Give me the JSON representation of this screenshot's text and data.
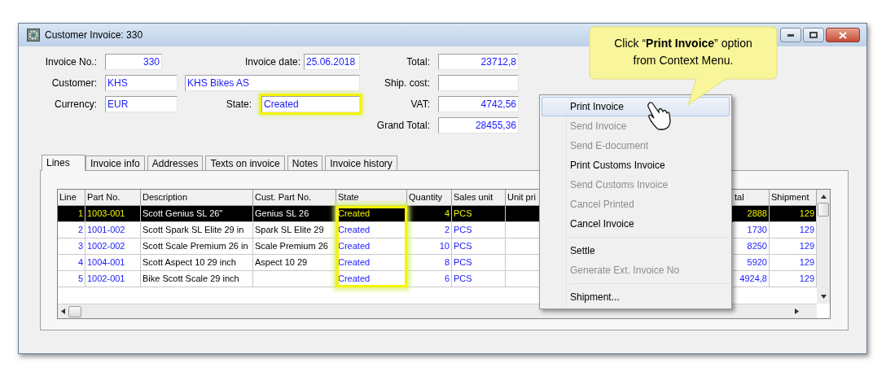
{
  "window": {
    "title": "Customer Invoice: 330"
  },
  "callout": {
    "text": "Click “**Print Invoice**” option from Context Menu."
  },
  "form": {
    "invoice_no": {
      "label": "Invoice No.:",
      "value": "330"
    },
    "invoice_date": {
      "label": "Invoice date:",
      "value": "25.06.2018"
    },
    "customer": {
      "label": "Customer:",
      "code": "KHS",
      "name": "KHS Bikes AS"
    },
    "currency": {
      "label": "Currency:",
      "value": "EUR"
    },
    "state": {
      "label": "State:",
      "value": "Created",
      "highlighted": true
    },
    "totals": [
      {
        "label": "Total:",
        "value": "23712,8"
      },
      {
        "label": "Ship. cost:"
      },
      {
        "label": "VAT:",
        "value": "4742,56"
      },
      {
        "label": "Grand Total:",
        "value": "28455,36"
      }
    ]
  },
  "tabs": [
    {
      "label": "Lines",
      "selected": true
    },
    {
      "label": "Invoice info",
      "selected": false
    },
    {
      "label": "Addresses",
      "selected": false
    },
    {
      "label": "Texts on invoice",
      "selected": false
    },
    {
      "label": "Notes",
      "selected": false
    },
    {
      "label": "Invoice history",
      "selected": false
    }
  ],
  "table": {
    "columns": [
      "Line",
      "Part No.",
      "Description",
      "Cust. Part No.",
      "State",
      "Quantity",
      "Sales unit",
      "Unit pri",
      "tal",
      "Shipment"
    ],
    "state_column_highlighted": true,
    "rows": [
      {
        "line": "1",
        "part_no": "1003-001",
        "description": "Scott Genius SL 26\"",
        "cust_part_no": "Genius SL 26",
        "state": "Created",
        "quantity": "4",
        "sales_unit": "PCS",
        "total": "2888",
        "shipment": "129",
        "selected": true
      },
      {
        "line": "2",
        "part_no": "1001-002",
        "description": "Scott Spark SL Elite 29 in",
        "cust_part_no": "Spark SL Elite 29",
        "state": "Created",
        "quantity": "2",
        "sales_unit": "PCS",
        "total": "1730",
        "shipment": "129",
        "selected": false
      },
      {
        "line": "3",
        "part_no": "1002-002",
        "description": "Scott Scale Premium 26 in",
        "cust_part_no": "Scale Premium 26",
        "state": "Created",
        "quantity": "10",
        "sales_unit": "PCS",
        "total": "8250",
        "shipment": "129",
        "selected": false
      },
      {
        "line": "4",
        "part_no": "1004-001",
        "description": "Scott Aspect 10 29 inch",
        "cust_part_no": "Aspect 10 29",
        "state": "Created",
        "quantity": "8",
        "sales_unit": "PCS",
        "total": "5920",
        "shipment": "129",
        "selected": false
      },
      {
        "line": "5",
        "part_no": "1002-001",
        "description": "Bike Scott Scale 29 inch",
        "state": "Created",
        "quantity": "6",
        "sales_unit": "PCS",
        "total": "4924,8",
        "shipment": "129",
        "selected": false
      }
    ]
  },
  "context_menu": {
    "items": [
      {
        "kind": "item",
        "label": "Print Invoice",
        "disabled": false,
        "selected": true
      },
      {
        "kind": "item",
        "label": "Send Invoice",
        "disabled": true,
        "selected": false
      },
      {
        "kind": "item",
        "label": "Send E-document",
        "disabled": true,
        "selected": false
      },
      {
        "kind": "item",
        "label": "Print Customs Invoice",
        "disabled": false,
        "selected": false
      },
      {
        "kind": "item",
        "label": "Send Customs Invoice",
        "disabled": true,
        "selected": false
      },
      {
        "kind": "item",
        "label": "Cancel Printed",
        "disabled": true,
        "selected": false
      },
      {
        "kind": "item",
        "label": "Cancel Invoice",
        "disabled": false,
        "selected": false
      },
      {
        "kind": "separator"
      },
      {
        "kind": "item",
        "label": "Settle",
        "disabled": false,
        "selected": false
      },
      {
        "kind": "item",
        "label": "Generate Ext. Invoice No",
        "disabled": true,
        "selected": false
      },
      {
        "kind": "separator"
      },
      {
        "kind": "item",
        "label": "Shipment...",
        "disabled": false,
        "selected": false
      }
    ]
  }
}
